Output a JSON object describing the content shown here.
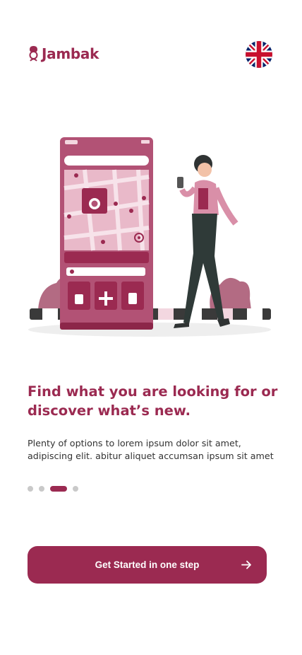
{
  "brand": {
    "name": "Jambak",
    "color": "#9b2a51"
  },
  "language": {
    "icon": "uk-flag-icon"
  },
  "onboarding": {
    "headline": "Find what you are looking for or discover what’s new.",
    "description": "Plenty of options to lorem ipsum dolor sit amet, adipiscing elit. abitur aliquet accumsan ipsum sit amet",
    "slides_total": 4,
    "active_slide": 3,
    "cta_label": "Get Started in one step",
    "cta_icon": "arrow-right-icon"
  },
  "colors": {
    "accent": "#9b2a51",
    "dot_inactive": "#c9c9c9",
    "text": "#333333"
  }
}
